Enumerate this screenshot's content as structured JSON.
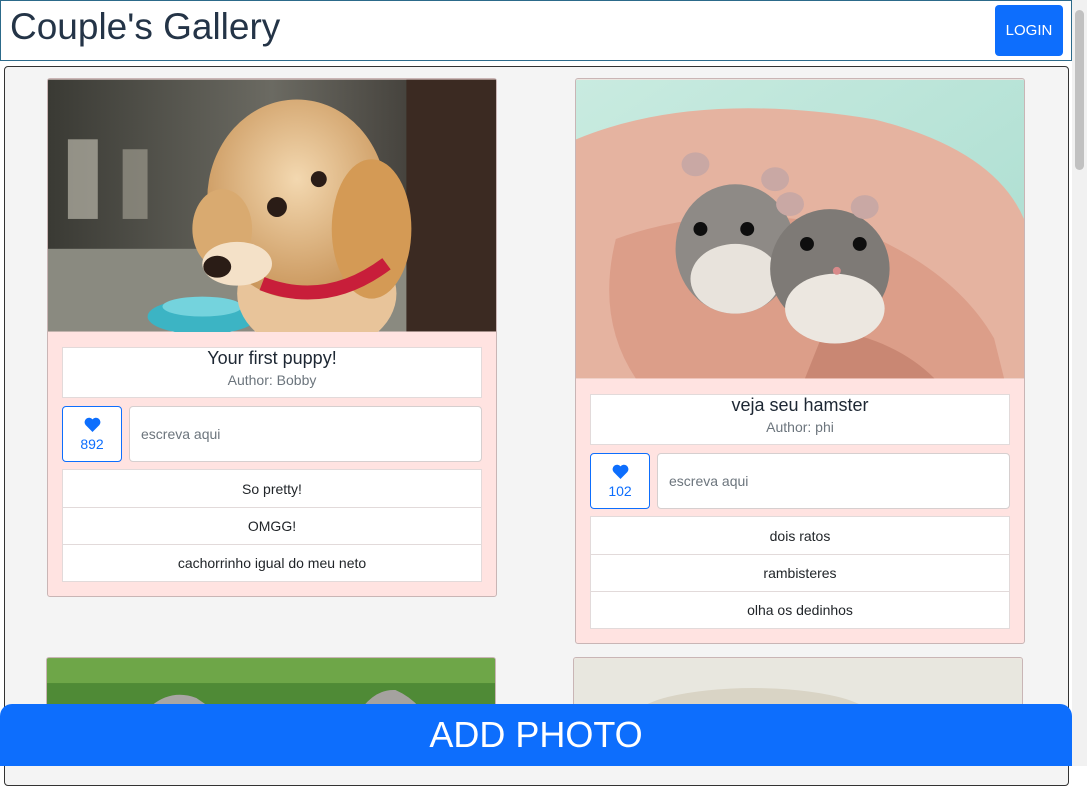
{
  "header": {
    "title": "Couple's Gallery",
    "login_label": "LOGIN"
  },
  "posts": [
    {
      "title": "Your first puppy!",
      "author": "Author: Bobby",
      "likes": "892",
      "comment_placeholder": "escreva aqui",
      "comments": [
        "So pretty!",
        "OMGG!",
        "cachorrinho igual do meu neto"
      ]
    },
    {
      "title": "veja seu hamster",
      "author": "Author: phi",
      "likes": "102",
      "comment_placeholder": "escreva aqui",
      "comments": [
        "dois ratos",
        "rambisteres",
        "olha os dedinhos"
      ]
    }
  ],
  "footer": {
    "add_photo_label": "ADD PHOTO"
  },
  "colors": {
    "primary": "#0d6efd",
    "card_bg": "#ffe3e1",
    "gallery_bg": "#f4f4f4"
  }
}
